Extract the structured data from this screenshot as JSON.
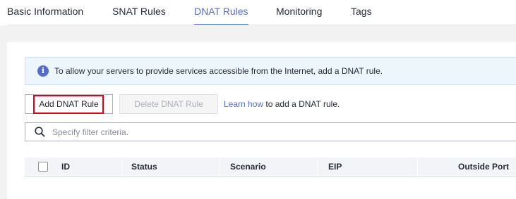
{
  "tabs": [
    {
      "label": "Basic Information",
      "active": false
    },
    {
      "label": "SNAT Rules",
      "active": false
    },
    {
      "label": "DNAT Rules",
      "active": true
    },
    {
      "label": "Monitoring",
      "active": false
    },
    {
      "label": "Tags",
      "active": false
    }
  ],
  "info_banner": {
    "icon": "info-icon",
    "text": "To allow your servers to provide services accessible from the Internet, add a DNAT rule."
  },
  "toolbar": {
    "add_label": "Add DNAT Rule",
    "delete_label": "Delete DNAT Rule",
    "learn_link": "Learn how",
    "learn_suffix": " to add a DNAT rule."
  },
  "search": {
    "icon": "search-icon",
    "placeholder": "Specify filter criteria."
  },
  "table": {
    "columns": [
      "ID",
      "Status",
      "Scenario",
      "EIP",
      "Outside Port"
    ]
  },
  "colors": {
    "accent": "#526ecc",
    "highlight": "#e0001b"
  }
}
